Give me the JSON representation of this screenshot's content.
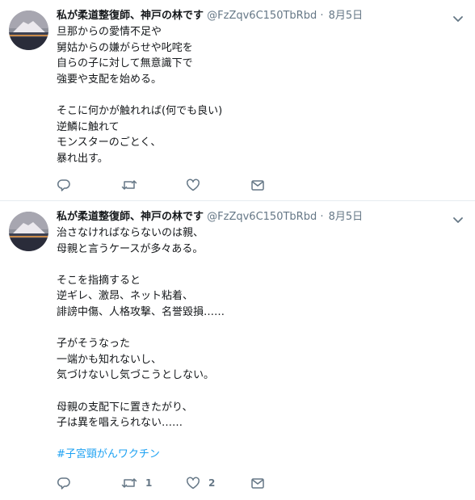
{
  "tweets": [
    {
      "name": "私が柔道整復師、神戸の林です",
      "handle": "@FzZqv6C150TbRbd",
      "separator": "·",
      "date": "8月5日",
      "lines": [
        "旦那からの愛情不足や",
        "舅姑からの嫌がらせや叱咤を",
        "自らの子に対して無意識下で",
        "強要や支配を始める。",
        "",
        "そこに何かが触れれば(何でも良い)",
        "逆鱗に触れて",
        "モンスターのごとく、",
        "暴れ出す。"
      ],
      "hashtag": "",
      "counts": {
        "reply": "",
        "retweet": "",
        "like": ""
      }
    },
    {
      "name": "私が柔道整復師、神戸の林です",
      "handle": "@FzZqv6C150TbRbd",
      "separator": "·",
      "date": "8月5日",
      "lines": [
        "治さなければならないのは親、",
        "母親と言うケースが多々ある。",
        "",
        "そこを指摘すると",
        "逆ギレ、激昂、ネット粘着、",
        "誹謗中傷、人格攻撃、名誉毀損……",
        "",
        "子がそうなった",
        "一端かも知れないし、",
        "気づけないし気づこうとしない。",
        "",
        "母親の支配下に置きたがり、",
        "子は異を唱えられない……",
        ""
      ],
      "hashtag": "#子宮頸がんワクチン",
      "counts": {
        "reply": "",
        "retweet": "1",
        "like": "2"
      }
    }
  ],
  "icons": {
    "reply": "reply-icon",
    "retweet": "retweet-icon",
    "like": "heart-icon",
    "dm": "envelope-icon",
    "caret": "chevron-down-icon"
  },
  "colors": {
    "name": "#14171a",
    "meta": "#657786",
    "hashtag": "#1da1f2",
    "divider": "#e6ecf0"
  }
}
